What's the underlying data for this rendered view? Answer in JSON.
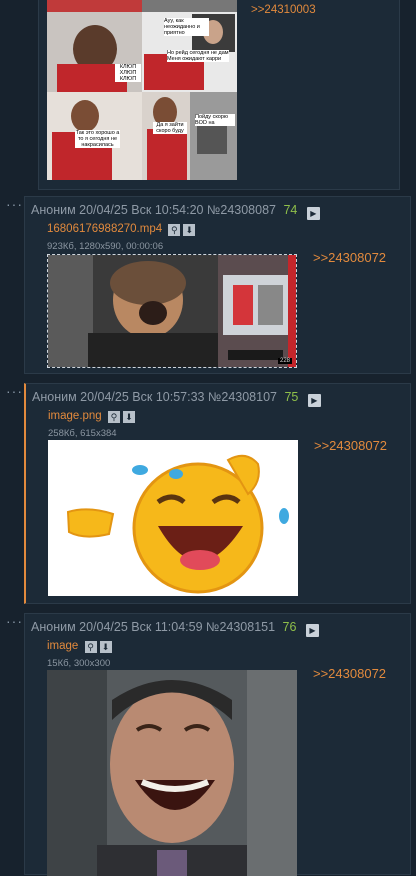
{
  "posts": [
    {
      "reply": ">>24310003",
      "captions": [
        "Ауу, как неожиданно и приятно",
        "Но рейд сегодня не дам Меня ожидают карри",
        "КЛЮП ХЛЮП КЛЮП",
        "Так это хорошо а то я сегодня не накрасилась",
        "Да я зайти скоро буду",
        "Пойду скорю BOD на"
      ]
    },
    {
      "dots": "···",
      "author": "Аноним",
      "date": "20/04/25 Вск 10:54:20",
      "number": "№24308087",
      "count": "74",
      "filename": "16806176988270.mp4",
      "meta": "923Кб, 1280x590, 00:00:06",
      "badge": "228",
      "reply": ">>24308072"
    },
    {
      "dots": "···",
      "author": "Аноним",
      "date": "20/04/25 Вск 10:57:33",
      "number": "№24308107",
      "count": "75",
      "filename": "image.png",
      "meta": "258Кб, 615x384",
      "reply": ">>24308072"
    },
    {
      "dots": "···",
      "author": "Аноним",
      "date": "20/04/25 Вск 11:04:59",
      "number": "№24308151",
      "count": "76",
      "filename": "image",
      "meta": "15Кб, 300x300",
      "reply": ">>24308072"
    }
  ],
  "icons": {
    "search": "search-icon",
    "download": "download-icon",
    "menu": "arrow-right-icon"
  },
  "colors": {
    "accent": "#e28a3d",
    "count": "#8fbf4a",
    "bg": "#17222d",
    "panel": "#1c2a37"
  }
}
